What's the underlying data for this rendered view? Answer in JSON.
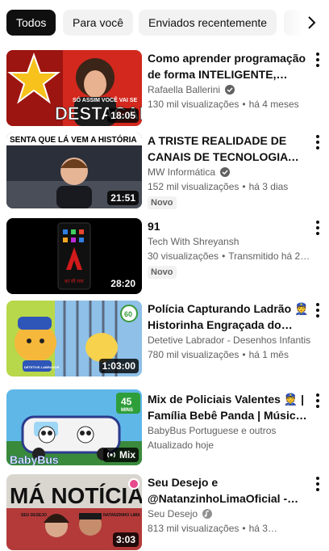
{
  "chips": [
    {
      "label": "Todos",
      "active": true
    },
    {
      "label": "Para você",
      "active": false
    },
    {
      "label": "Enviados recentemente",
      "active": false
    }
  ],
  "icons": {
    "next": "chevron-right-icon",
    "more": "more-vertical-icon",
    "verified": "verified-check-icon"
  },
  "videos": [
    {
      "title": "Como aprender programação de forma INTELIGENTE, sem…",
      "channel": "Rafaella Ballerini",
      "verified": true,
      "views": "130 mil visualizações",
      "age": "há 4 meses",
      "duration": "18:05",
      "badge": "",
      "thumb_text": [
        "SÓ ASSIM VOCÊ VAI SE",
        "DESTACAR"
      ]
    },
    {
      "title": "A TRISTE REALIDADE DE CANAIS DE TECNOLOGIA NO…",
      "channel": "MW Informática",
      "verified": true,
      "views": "152 mil visualizações",
      "age": "há 3 dias",
      "duration": "21:51",
      "badge": "Novo",
      "thumb_text": [
        "SENTA QUE LÁ VEM A HISTÓRIA"
      ]
    },
    {
      "title": "91",
      "channel": "Tech With Shreyansh",
      "verified": false,
      "views": "30 visualizações",
      "age": "Transmitido há 2…",
      "duration": "28:20",
      "badge": "Novo",
      "thumb_text": [
        "का सी राक"
      ]
    },
    {
      "title": "Polícia Capturando Ladrão 👮 Historinha Engraçada do…",
      "channel": "Detetive Labrador - Desenhos Infantis",
      "verified": false,
      "views": "780 mil visualizações",
      "age": "há 1 mês",
      "duration": "1:03:00",
      "badge": "",
      "thumb_text": [
        "60",
        "DETETIVE LABRADOR"
      ]
    },
    {
      "title": "Mix de Policiais Valentes 👮 | Família Bebê Panda | Músicas …",
      "channel": "BabyBus Portuguese e outros",
      "verified": false,
      "views": "",
      "age": "Atualizado hoje",
      "duration": "Mix",
      "badge": "",
      "thumb_text": [
        "45",
        "MINS",
        "BabyBus"
      ]
    },
    {
      "title": "Seu Desejo e @NatanzinhoLimaOficial - Má…",
      "channel": "Seu Desejo",
      "verified": true,
      "views": "813 mil visualizações",
      "age": "há 3…",
      "duration": "3:03",
      "badge": "",
      "thumb_text": [
        "MÁ NOTÍCIA",
        "SEU DESEJO",
        "NATANZINHO LIMA"
      ]
    }
  ]
}
